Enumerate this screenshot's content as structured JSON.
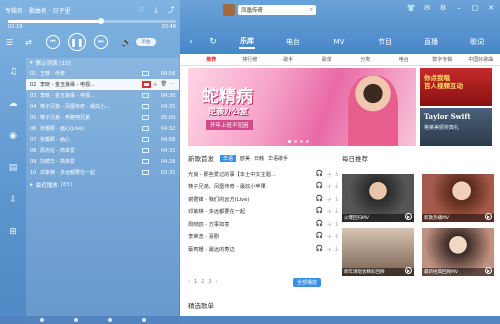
{
  "player": {
    "now_playing": "专辑名 · 歌曲名 · 日子里",
    "time_elapsed": "02:19",
    "time_total": "03:48",
    "progress": 0.55,
    "toggle_label": "单曲"
  },
  "playlist": {
    "header": "默认列表 [10]",
    "rows": [
      {
        "num": "01",
        "name": "王菲 - 传奇",
        "dur": "04:56",
        "active": false
      },
      {
        "num": "02",
        "name": "李晓 - 金玉良缘 - 电视...",
        "dur": "",
        "active": true
      },
      {
        "num": "03",
        "name": "李晓 - 金玉良缘 - 电视...",
        "dur": "04:30",
        "active": false
      },
      {
        "num": "04",
        "name": "筷子兄弟 - 凤凰传奇 - 最炫小...",
        "dur": "04:35",
        "active": false
      },
      {
        "num": "05",
        "name": "筷子兄弟 - 奔跑吧兄弟",
        "dur": "05:00",
        "active": false
      },
      {
        "num": "06",
        "name": "张靓颖 - 画心(Live)",
        "dur": "04:32",
        "active": false
      },
      {
        "num": "07",
        "name": "张靓颖 - 画心",
        "dur": "04:08",
        "active": false
      },
      {
        "num": "08",
        "name": "周杰伦 - 简单爱",
        "dur": "04:31",
        "active": false
      },
      {
        "num": "09",
        "name": "刘德华 - 简单爱",
        "dur": "04:28",
        "active": false
      },
      {
        "num": "10",
        "name": "邓紫棋 - 多远都要在一起",
        "dur": "03:31",
        "active": false
      }
    ],
    "footer": "最近播放",
    "footer_count": "[85]"
  },
  "top": {
    "search_value": "凤凰传奇",
    "nav_tabs": [
      "乐库",
      "电台",
      "MV",
      "节目",
      "直播",
      "歌词"
    ]
  },
  "subnav": [
    "推荐",
    "排行榜",
    "歌手",
    "歌单",
    "分类",
    "电台",
    "数字专辑",
    "中国好歌曲"
  ],
  "banner": {
    "title": "蛇精病",
    "subtitle": "逆袭办公室",
    "tag": "开年上班不犯困"
  },
  "ads": {
    "ad1_line1": "你点我唱",
    "ad1_line2": "百人视频互动",
    "ad2_title": "Taylor Swift",
    "ad2_sub": "格莱美颁奖典礼"
  },
  "new_songs": {
    "title": "新歌首发",
    "tabs": [
      "华语",
      "欧美",
      "日韩",
      "华语歌手"
    ],
    "items": [
      "光良 - 那些爱过的事【本土中文主题...",
      "筷子兄弟、凤凰传奇 - 最炫小苹果",
      "谢霆锋 - 我们的远方(Live)",
      "邓紫棋 - 多远都要在一起",
      "周晓鸥 - 万事如意",
      "李荣浩 - 喜剧",
      "蔡珂姗 - 最远的寿边"
    ],
    "pages": [
      "1",
      "2",
      "3"
    ],
    "play_all": "全部播放"
  },
  "daily": {
    "title": "每日推荐",
    "cards": [
      {
        "caption": "火爆回归MV"
      },
      {
        "caption": "新歌热播MV"
      },
      {
        "caption": "跨年演唱会精彩回顾"
      },
      {
        "caption": "最新经典回顾MV"
      }
    ]
  },
  "featured_title": "精选歌单"
}
